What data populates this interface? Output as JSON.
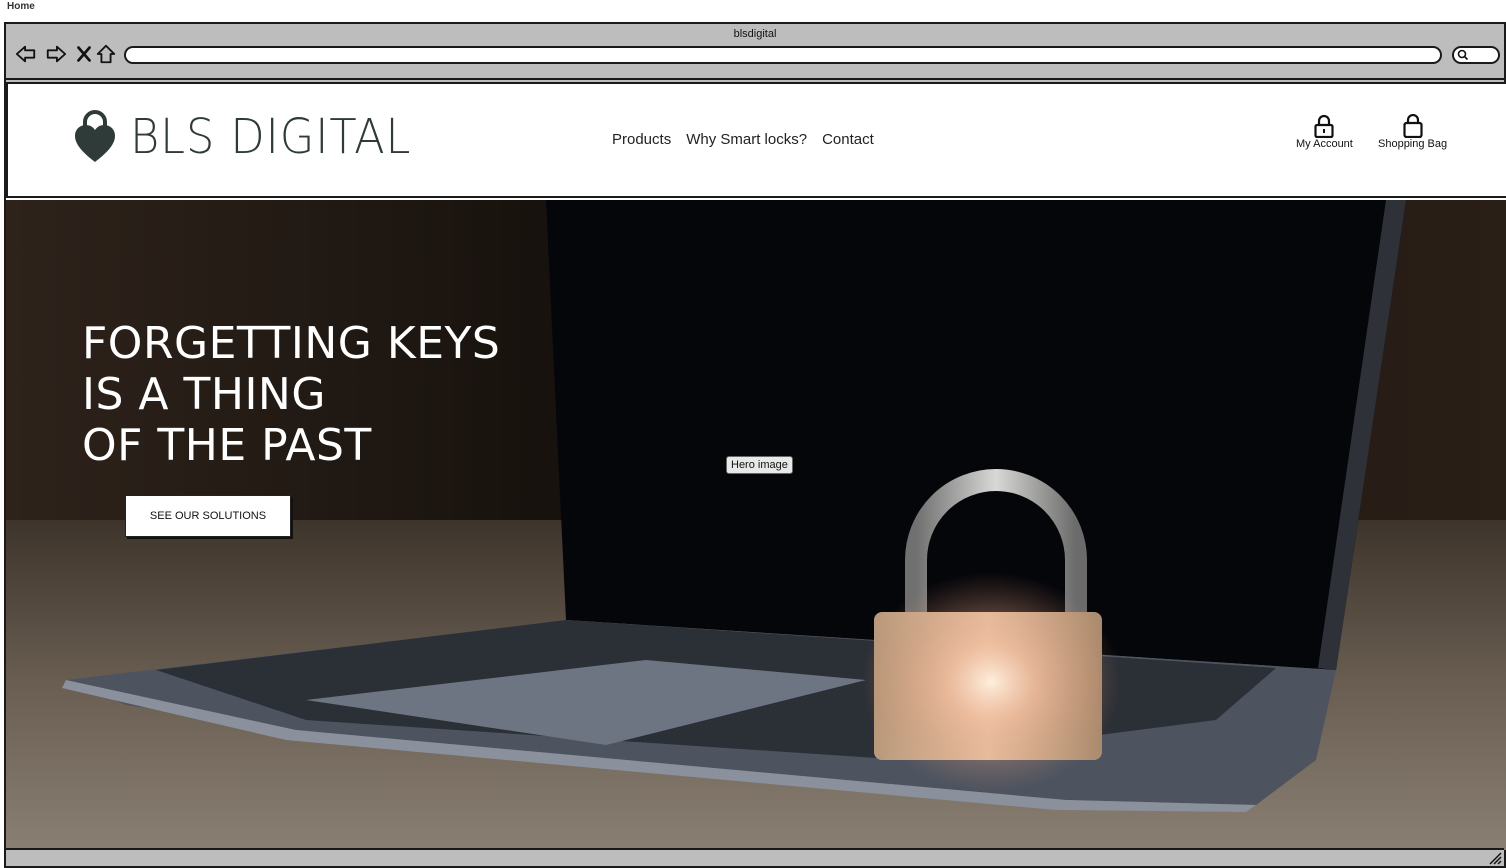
{
  "page": {
    "label": "Home"
  },
  "browser": {
    "title": "blsdigital",
    "address_value": "",
    "search_value": "",
    "icons": {
      "back": "back-arrow-icon",
      "forward": "forward-arrow-icon",
      "stop": "close-icon",
      "home": "home-icon",
      "search": "search-icon"
    }
  },
  "header": {
    "brand": "BLS DIGITAL",
    "logo_icon": "heart-padlock-icon",
    "nav": {
      "products": "Products",
      "why": "Why Smart locks?",
      "contact": "Contact"
    },
    "account_label": "My Account",
    "account_icon": "padlock-icon",
    "bag_label": "Shopping Bag",
    "bag_icon": "shopping-bag-icon"
  },
  "hero": {
    "heading_line1": "FORGETTING KEYS",
    "heading_line2": "IS A THING",
    "heading_line3": "OF THE PAST",
    "cta_label": "SEE OUR SOLUTIONS",
    "image_tag": "Hero image"
  },
  "colors": {
    "chrome": "#bdbdbd",
    "logo": "#2f3b38",
    "hero_text": "#ffffff"
  }
}
